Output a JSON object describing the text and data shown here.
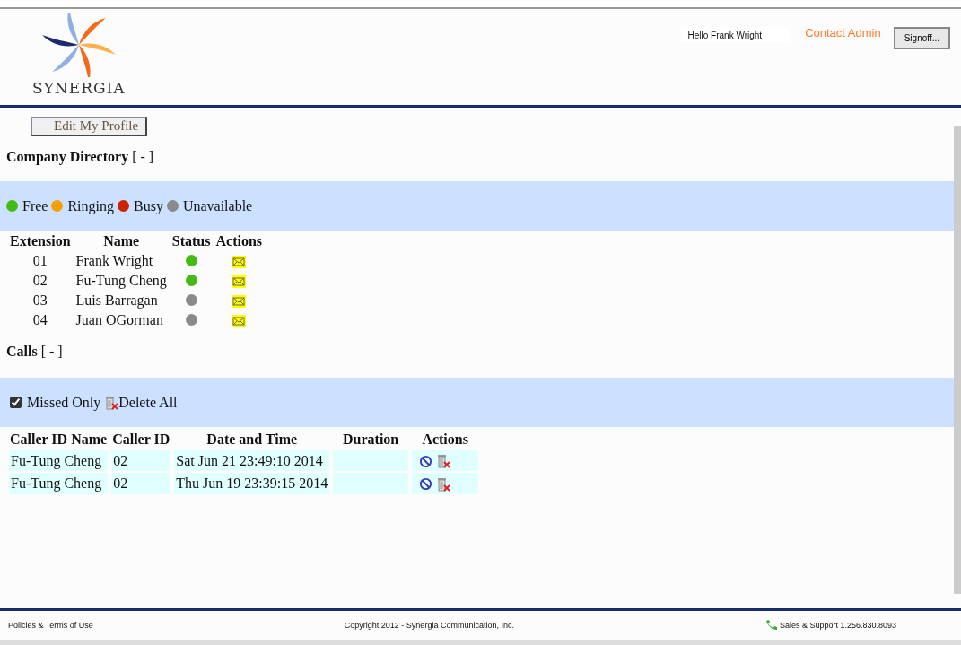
{
  "header": {
    "logo_text": "SYNERGIA",
    "greeting": "Hello Frank Wright",
    "contact_link": "Contact Admin",
    "signoff_button": "Signoff..."
  },
  "profile_button": "Edit My Profile",
  "directory": {
    "title": "Company Directory",
    "toggle": "[ - ]",
    "legend": [
      {
        "label": "Free",
        "color": "#44bb11"
      },
      {
        "label": "Ringing",
        "color": "#f5a000"
      },
      {
        "label": "Busy",
        "color": "#cc2200"
      },
      {
        "label": "Unavailable",
        "color": "#8a8a8a"
      }
    ],
    "columns": [
      "Extension",
      "Name",
      "Status",
      "Actions"
    ],
    "rows": [
      {
        "extension": "01",
        "name": "Frank Wright",
        "color": "#44bb11"
      },
      {
        "extension": "02",
        "name": "Fu-Tung Cheng",
        "color": "#44bb11"
      },
      {
        "extension": "03",
        "name": "Luis Barragan",
        "color": "#8a8a8a"
      },
      {
        "extension": "04",
        "name": "Juan OGorman",
        "color": "#8a8a8a"
      }
    ]
  },
  "calls": {
    "title": "Calls",
    "toggle": "[ - ]",
    "missed_only": {
      "label": "Missed Only",
      "checked": true
    },
    "delete_all": "Delete All",
    "columns": [
      "Caller ID Name",
      "Caller ID",
      "Date and Time",
      "Duration",
      "Actions"
    ],
    "rows": [
      {
        "caller_name": "Fu-Tung Cheng",
        "caller_id": "02",
        "date_time": "Sat Jun 21 23:49:10 2014"
      },
      {
        "caller_name": "Fu-Tung Cheng",
        "caller_id": "02",
        "date_time": "Thu Jun 19 23:39:15 2014"
      }
    ]
  },
  "footer": {
    "policies_link": "Policies & Terms of Use",
    "copyright": "Copyright 2012 - Synergia Communication, Inc.",
    "support": "Sales & Support 1.256.830.8093"
  }
}
